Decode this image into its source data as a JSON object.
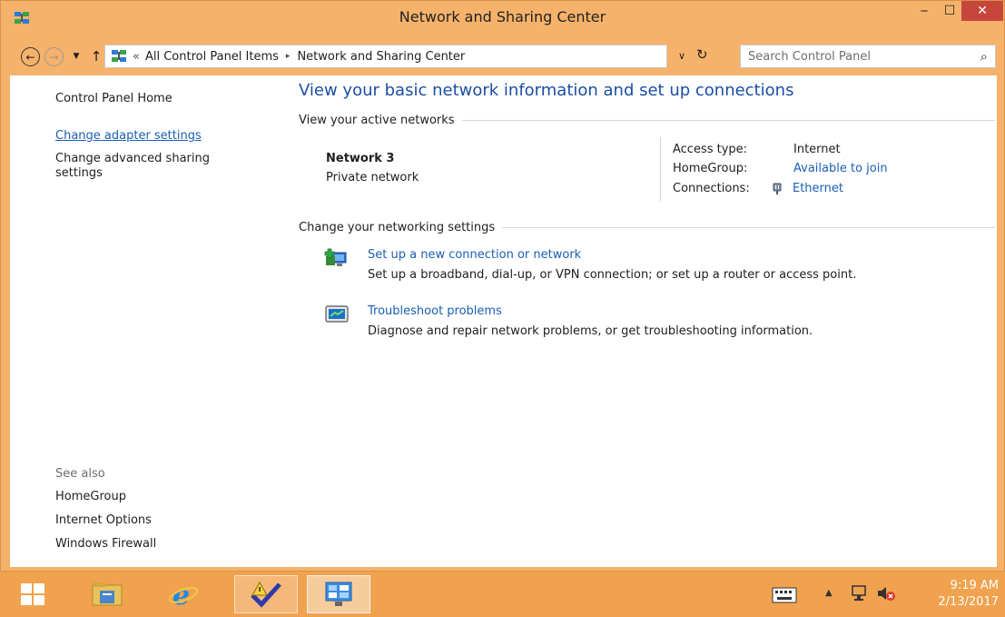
{
  "window": {
    "title": "Network and Sharing Center",
    "min_glyph": "‒",
    "max_glyph": "☐",
    "close_glyph": "✕"
  },
  "nav": {
    "back_glyph": "←",
    "forward_glyph": "→",
    "recent_glyph": "▼",
    "up_glyph": "↑",
    "breadcrumb_chevron": "«",
    "breadcrumb": [
      "All Control Panel Items",
      "Network and Sharing Center"
    ],
    "breadcrumb_sep": "▸",
    "dropdown_glyph": "∨",
    "refresh_glyph": "↻",
    "search_placeholder": "Search Control Panel",
    "search_glyph": "⌕"
  },
  "sidebar": {
    "home": "Control Panel Home",
    "change_adapter": "Change adapter settings",
    "change_advanced": "Change advanced sharing settings",
    "see_also": "See also",
    "see_also_links": [
      "HomeGroup",
      "Internet Options",
      "Windows Firewall"
    ]
  },
  "main": {
    "title": "View your basic network information and set up connections",
    "active_header": "View your active networks",
    "network_name": "Network  3",
    "network_type": "Private network",
    "access_label": "Access type:",
    "access_value": "Internet",
    "homegroup_label": "HomeGroup:",
    "homegroup_value": "Available to join",
    "connections_label": "Connections:",
    "connections_value": "Ethernet",
    "change_header": "Change your networking settings",
    "tasks": [
      {
        "link": "Set up a new connection or network",
        "desc": "Set up a broadband, dial-up, or VPN connection; or set up a router or access point."
      },
      {
        "link": "Troubleshoot problems",
        "desc": "Diagnose and repair network problems, or get troubleshooting information."
      }
    ]
  },
  "taskbar": {
    "time": "9:19 AM",
    "date": "2/13/2017",
    "tray_chevron": "▲"
  },
  "colors": {
    "accent": "#f6b26b",
    "taskbar": "#f0a24e",
    "link": "#1a5fb4",
    "title_blue": "#1b4ea3"
  }
}
